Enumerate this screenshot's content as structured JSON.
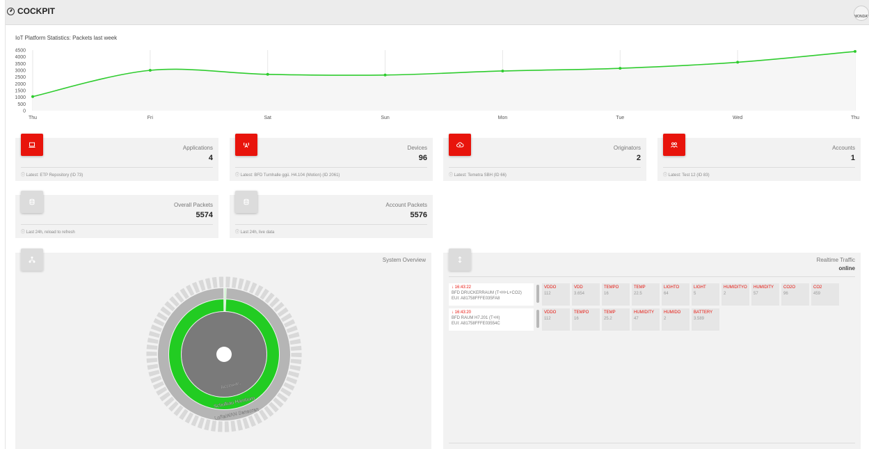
{
  "app": {
    "title": "COCKPIT",
    "logo_text": "MONDAY"
  },
  "chart_data": {
    "type": "line",
    "title": "IoT Platform Statistics: Packets last week",
    "categories": [
      "Thu",
      "Fri",
      "Sat",
      "Sun",
      "Mon",
      "Tue",
      "Wed",
      "Thu"
    ],
    "series": [
      {
        "values": [
          1050,
          3000,
          2700,
          2650,
          2950,
          3150,
          3600,
          4400
        ]
      }
    ],
    "yticks": [
      0,
      500,
      1000,
      1500,
      2000,
      2500,
      3000,
      3500,
      4000,
      4500
    ],
    "ylim": [
      0,
      4500
    ],
    "line_color": "#2ecc2e",
    "grid": "vertical"
  },
  "stats": [
    {
      "label": "Applications",
      "value": "4",
      "footer": "ⓘ Latest: ETP Repository (ID 73)",
      "icon": "laptop-icon"
    },
    {
      "label": "Devices",
      "value": "96",
      "footer": "ⓘ Latest: BFD Turnhalle ggü. H4.104 (Motion) (ID 2061)",
      "icon": "antenna-icon"
    },
    {
      "label": "Originators",
      "value": "2",
      "footer": "ⓘ Latest: Temetra SBH (ID 66)",
      "icon": "cloud-upload-icon"
    },
    {
      "label": "Accounts",
      "value": "1",
      "footer": "ⓘ Latest: Test 12 (ID 83)",
      "icon": "users-icon"
    }
  ],
  "packets": [
    {
      "label": "Overall Packets",
      "value": "5574",
      "footer": "ⓘ Last 24h, reload to refresh",
      "icon": "database-icon"
    },
    {
      "label": "Account Packets",
      "value": "5576",
      "footer": "ⓘ Last 24h, live data",
      "icon": "database-icon"
    }
  ],
  "system_overview": {
    "title": "System Overview",
    "rings": [
      "Accounts",
      "Schulbau Hamburg",
      "LoRaWAN Sensoren"
    ],
    "colors": {
      "inner": "#7a7a7a",
      "middle": "#22cc22",
      "outer": "#b5b5b5",
      "outer_band": "#d9d9d9"
    }
  },
  "traffic": {
    "title": "Realtime Traffic",
    "status": "online",
    "rows": [
      {
        "time": "↓ 16:43:22",
        "name": "BFD DRUCKERRAUM (T+H+L+CO2)",
        "eui": "EUI: A81758FFFE035FA8",
        "values": [
          {
            "k": "VDDO",
            "v": "112"
          },
          {
            "k": "VDD",
            "v": "3.654"
          },
          {
            "k": "TEMPO",
            "v": "16"
          },
          {
            "k": "TEMP",
            "v": "22.5"
          },
          {
            "k": "LIGHTO",
            "v": "64"
          },
          {
            "k": "LIGHT",
            "v": "5"
          },
          {
            "k": "HUMIDITYO",
            "v": "2"
          },
          {
            "k": "HUMIDITY",
            "v": "57"
          },
          {
            "k": "CO2O",
            "v": "96"
          },
          {
            "k": "CO2",
            "v": "459"
          }
        ]
      },
      {
        "time": "↓ 16:43:20",
        "name": "BFD RAUM H7.201 (T+H)",
        "eui": "EUI: A81758FFFE03554C",
        "values": [
          {
            "k": "VDDO",
            "v": "112"
          },
          {
            "k": "TEMPO",
            "v": "16"
          },
          {
            "k": "TEMP",
            "v": "25.2"
          },
          {
            "k": "HUMIDITY",
            "v": "47"
          },
          {
            "k": "HUMIDO",
            "v": "2"
          },
          {
            "k": "BATTERY",
            "v": "3.589"
          }
        ]
      }
    ]
  }
}
